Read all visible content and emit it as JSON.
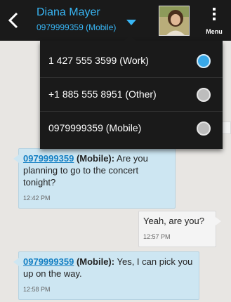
{
  "header": {
    "contact_name": "Diana Mayer",
    "contact_number": "0979999359 (Mobile)",
    "menu_label": "Menu"
  },
  "number_menu": {
    "options": [
      {
        "label": "1 427 555 3599 (Work)",
        "selected": true
      },
      {
        "label": "+1 885 555 8951 (Other)",
        "selected": false
      },
      {
        "label": "0979999359 (Mobile)",
        "selected": false
      }
    ]
  },
  "messages": [
    {
      "direction": "in",
      "sender": "0979999359",
      "tag": "(Mobile):",
      "text": "Are you planning to go to the concert tonight?",
      "time": "12:42 PM"
    },
    {
      "direction": "out",
      "text": "Yeah, are you?",
      "time": "12:57 PM"
    },
    {
      "direction": "in",
      "sender": "0979999359",
      "tag": "(Mobile):",
      "text": "Yes, I can pick you up on the way.",
      "time": "12:58 PM"
    }
  ],
  "colors": {
    "accent": "#38b6f5",
    "topbar": "#1a1a1a",
    "incoming_bubble": "#cde6f2",
    "outgoing_bubble": "#f4f4f4"
  }
}
